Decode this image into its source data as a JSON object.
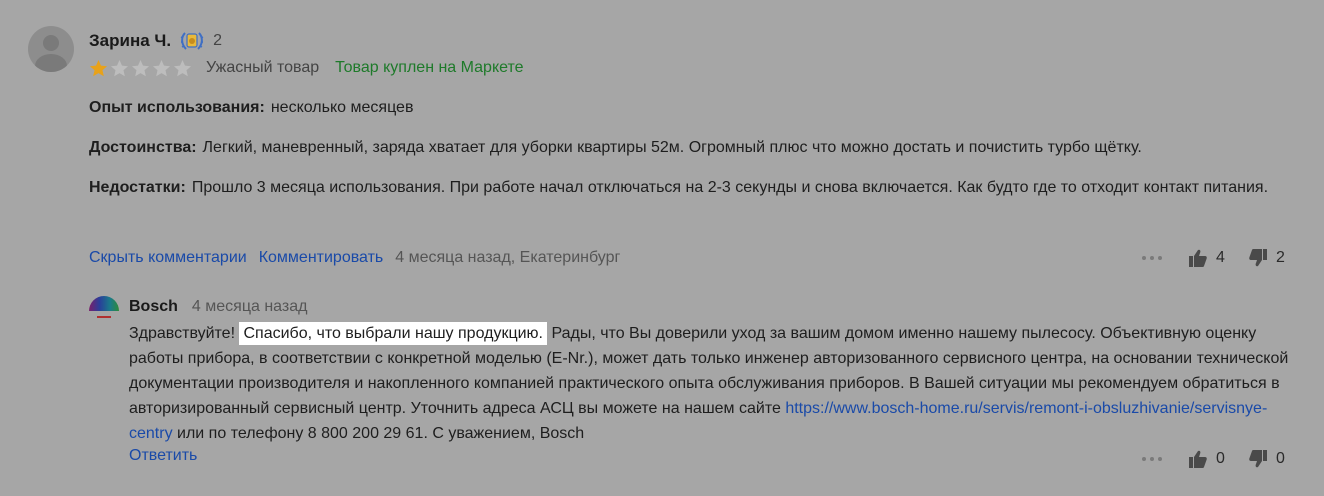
{
  "review": {
    "author": "Зарина Ч.",
    "badge_icon": "laurel-badge-icon",
    "badge_count": "2",
    "rating": {
      "value": 1,
      "max": 5,
      "filled_color": "#e8a21a",
      "empty_color": "#bdbdbd",
      "label": "Ужасный товар"
    },
    "purchase_note": "Товар куплен на Маркете",
    "fields": [
      {
        "label": "Опыт использования:",
        "text": "несколько месяцев"
      },
      {
        "label": "Достоинства:",
        "text": "Легкий, маневренный, заряда хватает для уборки квартиры 52м. Огромный плюс что можно достать и почистить турбо щётку."
      },
      {
        "label": "Недостатки:",
        "text": "Прошло 3 месяца использования. При работе начал отключаться на 2-3 секунды и снова включается. Как будто где то отходит контакт питания."
      }
    ],
    "actions": {
      "hide_comments": "Скрыть комментарии",
      "comment": "Комментировать",
      "meta": "4 месяца назад, Екатеринбург"
    },
    "votes": {
      "likes": "4",
      "dislikes": "2"
    }
  },
  "reply": {
    "author": "Bosch",
    "date": "4 месяца назад",
    "text_before": "Здравствуйте! ",
    "text_highlight": "Спасибо, что выбрали нашу продукцию.",
    "text_after": " Рады, что Вы доверили уход за вашим домом именно нашему пылесосу. Объективную оценку работы прибора, в соответствии с конкретной моделью (E-Nr.), может дать только инженер авторизованного сервисного центра, на основании технической документации производителя и накопленного компанией практического опыта обслуживания приборов. В Вашей ситуации мы рекомендуем обратиться в авторизированный сервисный центр. Уточнить адреса АСЦ вы можете на нашем сайте ",
    "link": "https://www.bosch-home.ru/servis/remont-i-obsluzhivanie/servisnye-centry",
    "text_end": " или по телефону 8 800 200 29 61. С уважением, Bosch",
    "reply_label": "Ответить",
    "votes": {
      "likes": "0",
      "dislikes": "0"
    }
  },
  "colors": {
    "background": "#a6a6a6",
    "link": "#1a4aa8",
    "green": "#1e7a2a",
    "highlight": "#ffffff"
  }
}
